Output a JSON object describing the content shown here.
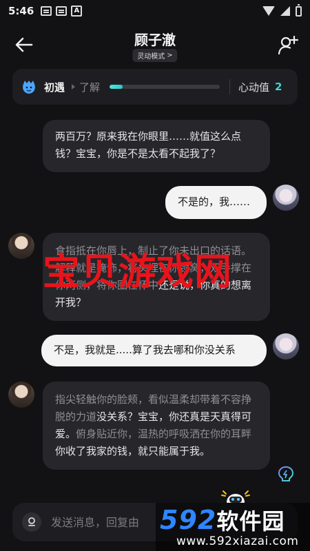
{
  "status_bar": {
    "time": "5:46",
    "notification_icons": [
      "message-icon",
      "message-icon",
      "a-icon"
    ],
    "right_icons": [
      "wifi-icon",
      "signal-icon",
      "battery-icon"
    ]
  },
  "header": {
    "title": "顾子澈",
    "mode_label": "灵动模式",
    "mode_chevron": ">"
  },
  "relationship": {
    "stage": "初遇",
    "next_stage": "了解",
    "progress": 0.12,
    "affinity_label": "心动值",
    "affinity_value": "2",
    "accent_color": "#3fd6d0"
  },
  "messages": [
    {
      "role": "ai",
      "text": "两百万？原来我在你眼里……就值这么点钱？宝宝，你是不是太看不起我了？"
    },
    {
      "role": "user",
      "text": "不是的，我……"
    },
    {
      "role": "ai",
      "narration": "食指抵在你唇上，制止了你未出口的话语。解释就是掩饰，将头埋在你颈窝，双手撑在你两侧，将你圈在怀中",
      "text": "还是说，你真的想离开我？"
    },
    {
      "role": "user",
      "text": "不是，我就是.....算了我去哪和你没关系"
    },
    {
      "role": "ai",
      "narration": "指尖轻触你的脸颊，看似温柔却带着不容挣脱的力道",
      "text": "没关系？宝宝，你还真是天真得可爱。",
      "narration2": "俯身贴近你，温热的呼吸洒在你的耳畔",
      "text2": "你收了我家的钱，就只能属于我。"
    }
  ],
  "input": {
    "placeholder": "发送消息，回复由"
  },
  "watermark": {
    "text": "宝贝游戏网",
    "color": "#e8141b"
  },
  "brand": {
    "logo_num": "592",
    "logo_cn": "软件园",
    "url": "www.592xiazai.com",
    "color": "#2f86ff"
  }
}
